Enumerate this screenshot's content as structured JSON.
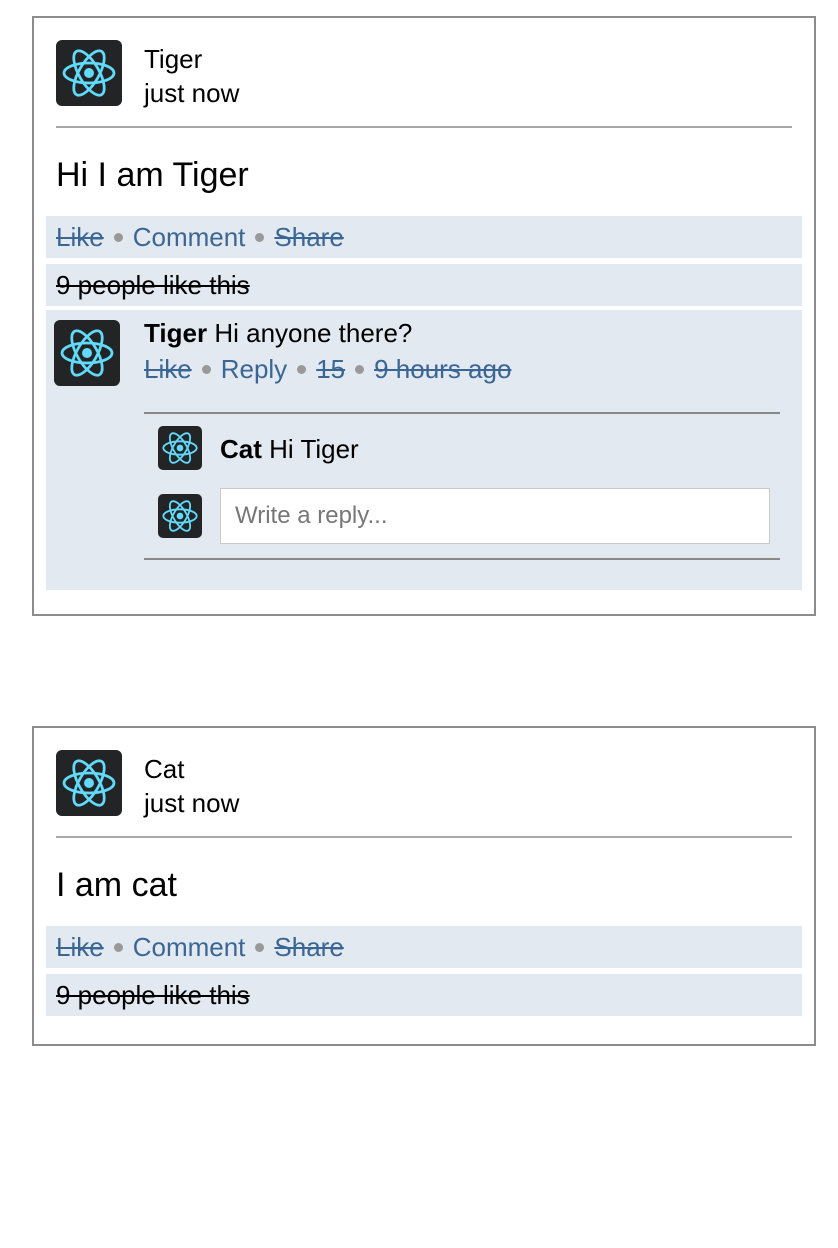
{
  "posts": [
    {
      "author": "Tiger",
      "time": "just now",
      "body": "Hi I am Tiger",
      "actions": {
        "like": "Like",
        "comment": "Comment",
        "share": "Share"
      },
      "likes_text": "9 people like this",
      "comment": {
        "author": "Tiger",
        "text": "Hi anyone there?",
        "like": "Like",
        "reply": "Reply",
        "count": "15",
        "time": "9 hours ago",
        "replies": [
          {
            "author": "Cat",
            "text": "Hi Tiger"
          }
        ],
        "reply_placeholder": "Write a reply..."
      }
    },
    {
      "author": "Cat",
      "time": "just now",
      "body": "I am cat",
      "actions": {
        "like": "Like",
        "comment": "Comment",
        "share": "Share"
      },
      "likes_text": "9 people like this"
    }
  ],
  "icons": {
    "avatar": "react-atom-icon",
    "avatar_bg": "#222426",
    "avatar_fg": "#61dafb"
  },
  "colors": {
    "link": "#3b6694",
    "bar_bg": "#e2e9f0",
    "border": "#8c8c8c"
  }
}
